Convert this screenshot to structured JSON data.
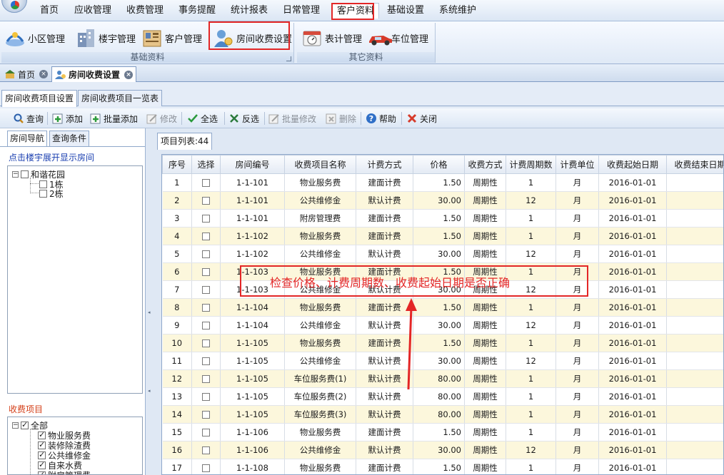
{
  "menu": {
    "items": [
      "首页",
      "应收管理",
      "收费管理",
      "事务提醒",
      "统计报表",
      "日常管理",
      "客户资料",
      "基础设置",
      "系统维护"
    ],
    "active": "客户资料"
  },
  "ribbon": {
    "groups": [
      {
        "label": "基础资料",
        "buttons": [
          "小区管理",
          "楼宇管理",
          "客户管理",
          "房间收费设置"
        ]
      },
      {
        "label": "其它资料",
        "buttons": [
          "表计管理",
          "车位管理"
        ]
      }
    ]
  },
  "doc_tabs": [
    {
      "label": "首页",
      "close": "×"
    },
    {
      "label": "房间收费设置",
      "close": "×"
    }
  ],
  "sub_tabs": [
    "房间收费项目设置",
    "房间收费项目一览表"
  ],
  "toolbar": {
    "buttons": [
      {
        "label": "查询",
        "icon": "search-icon",
        "enabled": true
      },
      {
        "label": "添加",
        "icon": "add-icon",
        "enabled": true
      },
      {
        "label": "批量添加",
        "icon": "batch-add-icon",
        "enabled": true
      },
      {
        "label": "修改",
        "icon": "edit-icon",
        "enabled": false
      },
      {
        "label": "全选",
        "icon": "check-icon",
        "enabled": true
      },
      {
        "label": "反选",
        "icon": "invert-icon",
        "enabled": true
      },
      {
        "label": "批量修改",
        "icon": "batch-edit-icon",
        "enabled": false
      },
      {
        "label": "删除",
        "icon": "delete-icon",
        "enabled": false
      },
      {
        "label": "帮助",
        "icon": "help-icon",
        "enabled": true
      },
      {
        "label": "关闭",
        "icon": "close-icon",
        "enabled": true
      }
    ]
  },
  "left": {
    "tabs": [
      "房间导航",
      "查询条件"
    ],
    "hint": "点击楼宇展开显示房间",
    "tree": {
      "root": "和谐花园",
      "children": [
        "1栋",
        "2栋"
      ],
      "root_toggle": "−"
    },
    "fee_title": "收费项目",
    "fee_tree": {
      "root": "全部",
      "root_toggle": "−",
      "children": [
        "物业服务费",
        "装修除渣费",
        "公共维修金",
        "自来水费",
        "附房管理费"
      ]
    }
  },
  "grid": {
    "tab_label": "项目列表:44",
    "columns": [
      "序号",
      "选择",
      "房间编号",
      "收费项目名称",
      "计费方式",
      "价格",
      "收费方式",
      "计费周期数",
      "计费单位",
      "收费起始日期",
      "收费结束日期"
    ],
    "rows": [
      [
        "1",
        "",
        "1-1-101",
        "物业服务费",
        "建面计费",
        "1.50",
        "周期性",
        "1",
        "月",
        "2016-01-01",
        ""
      ],
      [
        "2",
        "",
        "1-1-101",
        "公共维修金",
        "默认计费",
        "30.00",
        "周期性",
        "12",
        "月",
        "2016-01-01",
        ""
      ],
      [
        "3",
        "",
        "1-1-101",
        "附房管理费",
        "建面计费",
        "1.50",
        "周期性",
        "1",
        "月",
        "2016-01-01",
        ""
      ],
      [
        "4",
        "",
        "1-1-102",
        "物业服务费",
        "建面计费",
        "1.50",
        "周期性",
        "1",
        "月",
        "2016-01-01",
        ""
      ],
      [
        "5",
        "",
        "1-1-102",
        "公共维修金",
        "默认计费",
        "30.00",
        "周期性",
        "12",
        "月",
        "2016-01-01",
        ""
      ],
      [
        "6",
        "",
        "1-1-103",
        "物业服务费",
        "建面计费",
        "1.50",
        "周期性",
        "1",
        "月",
        "2016-01-01",
        ""
      ],
      [
        "7",
        "",
        "1-1-103",
        "公共维修金",
        "默认计费",
        "30.00",
        "周期性",
        "12",
        "月",
        "2016-01-01",
        ""
      ],
      [
        "8",
        "",
        "1-1-104",
        "物业服务费",
        "建面计费",
        "1.50",
        "周期性",
        "1",
        "月",
        "2016-01-01",
        ""
      ],
      [
        "9",
        "",
        "1-1-104",
        "公共维修金",
        "默认计费",
        "30.00",
        "周期性",
        "12",
        "月",
        "2016-01-01",
        ""
      ],
      [
        "10",
        "",
        "1-1-105",
        "物业服务费",
        "建面计费",
        "1.50",
        "周期性",
        "1",
        "月",
        "2016-01-01",
        ""
      ],
      [
        "11",
        "",
        "1-1-105",
        "公共维修金",
        "默认计费",
        "30.00",
        "周期性",
        "12",
        "月",
        "2016-01-01",
        ""
      ],
      [
        "12",
        "",
        "1-1-105",
        "车位服务费(1)",
        "默认计费",
        "80.00",
        "周期性",
        "1",
        "月",
        "2016-01-01",
        ""
      ],
      [
        "13",
        "",
        "1-1-105",
        "车位服务费(2)",
        "默认计费",
        "80.00",
        "周期性",
        "1",
        "月",
        "2016-01-01",
        ""
      ],
      [
        "14",
        "",
        "1-1-105",
        "车位服务费(3)",
        "默认计费",
        "80.00",
        "周期性",
        "1",
        "月",
        "2016-01-01",
        ""
      ],
      [
        "15",
        "",
        "1-1-106",
        "物业服务费",
        "建面计费",
        "1.50",
        "周期性",
        "1",
        "月",
        "2016-01-01",
        ""
      ],
      [
        "16",
        "",
        "1-1-106",
        "公共维修金",
        "默认计费",
        "30.00",
        "周期性",
        "12",
        "月",
        "2016-01-01",
        ""
      ],
      [
        "17",
        "",
        "1-1-108",
        "物业服务费",
        "建面计费",
        "1.50",
        "周期性",
        "1",
        "月",
        "2016-01-01",
        ""
      ]
    ]
  },
  "annotation": {
    "text": "检查价格、计费周期数、收费起始日期是否正确",
    "color": "#e32626"
  },
  "colors": {
    "accent": "#e32626",
    "link": "#1a3fb0",
    "section": "#d4401a",
    "row_alt": "#fcf7dc"
  }
}
